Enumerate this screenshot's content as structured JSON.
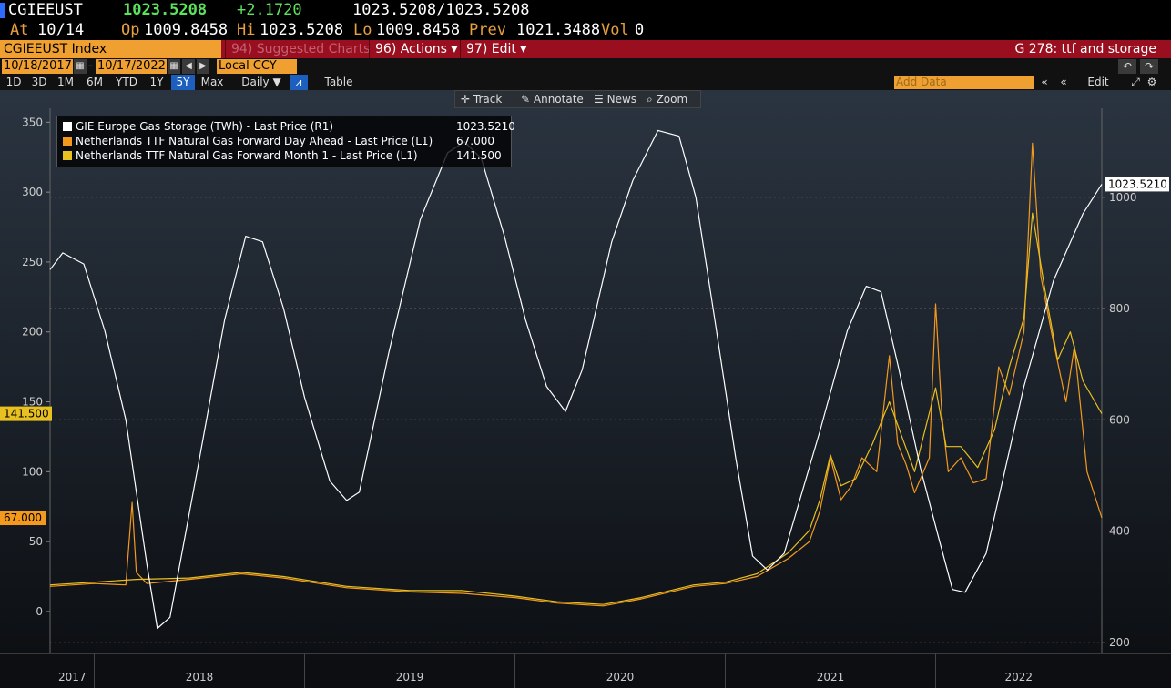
{
  "header": {
    "ticker": "CGIEEUST",
    "last": "1023.5208",
    "change": "+2.1720",
    "bidask": "1023.5208/1023.5208",
    "at_label": "At",
    "at_value": "10/14",
    "op_label": "Op",
    "op_value": "1009.8458",
    "hi_label": "Hi",
    "hi_value": "1023.5208",
    "lo_label": "Lo",
    "lo_value": "1009.8458",
    "prev_label": "Prev",
    "prev_value": "1021.3488",
    "vol_label": "Vol",
    "vol_value": "0"
  },
  "menubar": {
    "security": "CGIEEUST Index",
    "suggested": "94) Suggested Charts",
    "actions": "96) Actions ▾",
    "edit": "97) Edit ▾",
    "title": "G 278: ttf and storage"
  },
  "daterow": {
    "start": "10/18/2017",
    "end": "10/17/2022",
    "currency": "Local CCY"
  },
  "ranges": [
    "1D",
    "3D",
    "1M",
    "6M",
    "YTD",
    "1Y",
    "5Y",
    "Max"
  ],
  "active_range": "5Y",
  "frequency": "Daily ▼",
  "table_label": "Table",
  "add_data_placeholder": "Add Data",
  "edit_chart": "Edit Chart",
  "chart_toolbar": {
    "track": "Track",
    "annotate": "Annotate",
    "news": "News",
    "zoom": "Zoom"
  },
  "colors": {
    "storage": "#ffffff",
    "day_ahead": "#f39a1e",
    "month1": "#e8c020",
    "accent": "#f0a030",
    "menubar": "#9a0f1f"
  },
  "chart_data": {
    "type": "line",
    "x_labels": [
      "2017",
      "2018",
      "2019",
      "2020",
      "2021",
      "2022"
    ],
    "left_axis": {
      "ticks": [
        0,
        50,
        100,
        150,
        200,
        250,
        300,
        350
      ],
      "range": [
        -30,
        360
      ]
    },
    "right_axis": {
      "ticks": [
        200,
        400,
        600,
        800,
        1000
      ],
      "range": [
        180,
        1160
      ]
    },
    "series": [
      {
        "name": "GIE Europe Gas Storage (TWh) - Last Price (R1)",
        "last": "1023.5210",
        "axis": "right",
        "points": [
          [
            2017.79,
            870
          ],
          [
            2017.85,
            900
          ],
          [
            2017.95,
            880
          ],
          [
            2018.05,
            760
          ],
          [
            2018.15,
            600
          ],
          [
            2018.25,
            340
          ],
          [
            2018.3,
            225
          ],
          [
            2018.36,
            245
          ],
          [
            2018.5,
            530
          ],
          [
            2018.62,
            780
          ],
          [
            2018.72,
            930
          ],
          [
            2018.8,
            920
          ],
          [
            2018.9,
            800
          ],
          [
            2019.0,
            640
          ],
          [
            2019.12,
            490
          ],
          [
            2019.2,
            455
          ],
          [
            2019.26,
            470
          ],
          [
            2019.4,
            720
          ],
          [
            2019.55,
            960
          ],
          [
            2019.68,
            1080
          ],
          [
            2019.76,
            1100
          ],
          [
            2019.84,
            1070
          ],
          [
            2019.95,
            930
          ],
          [
            2020.05,
            780
          ],
          [
            2020.15,
            660
          ],
          [
            2020.24,
            615
          ],
          [
            2020.32,
            690
          ],
          [
            2020.46,
            920
          ],
          [
            2020.56,
            1030
          ],
          [
            2020.68,
            1120
          ],
          [
            2020.78,
            1110
          ],
          [
            2020.86,
            1000
          ],
          [
            2020.95,
            780
          ],
          [
            2021.05,
            530
          ],
          [
            2021.13,
            355
          ],
          [
            2021.2,
            330
          ],
          [
            2021.28,
            360
          ],
          [
            2021.45,
            580
          ],
          [
            2021.58,
            760
          ],
          [
            2021.67,
            840
          ],
          [
            2021.74,
            830
          ],
          [
            2021.82,
            700
          ],
          [
            2021.93,
            510
          ],
          [
            2022.02,
            380
          ],
          [
            2022.08,
            295
          ],
          [
            2022.14,
            290
          ],
          [
            2022.24,
            360
          ],
          [
            2022.42,
            660
          ],
          [
            2022.56,
            850
          ],
          [
            2022.7,
            970
          ],
          [
            2022.79,
            1023.5
          ]
        ]
      },
      {
        "name": "Netherlands TTF Natural Gas Forward Day Ahead - Last Price (L1)",
        "last": "67.000",
        "axis": "left",
        "points": [
          [
            2017.79,
            18
          ],
          [
            2018.0,
            20
          ],
          [
            2018.15,
            19
          ],
          [
            2018.18,
            78
          ],
          [
            2018.2,
            28
          ],
          [
            2018.25,
            20
          ],
          [
            2018.45,
            23
          ],
          [
            2018.7,
            27
          ],
          [
            2018.9,
            24
          ],
          [
            2019.2,
            17
          ],
          [
            2019.5,
            14
          ],
          [
            2019.75,
            13
          ],
          [
            2020.0,
            10
          ],
          [
            2020.2,
            6
          ],
          [
            2020.42,
            4
          ],
          [
            2020.6,
            9
          ],
          [
            2020.85,
            18
          ],
          [
            2021.0,
            20
          ],
          [
            2021.15,
            25
          ],
          [
            2021.3,
            38
          ],
          [
            2021.4,
            50
          ],
          [
            2021.45,
            72
          ],
          [
            2021.5,
            110
          ],
          [
            2021.55,
            80
          ],
          [
            2021.6,
            90
          ],
          [
            2021.65,
            110
          ],
          [
            2021.72,
            100
          ],
          [
            2021.78,
            183
          ],
          [
            2021.82,
            120
          ],
          [
            2021.86,
            105
          ],
          [
            2021.9,
            85
          ],
          [
            2021.97,
            110
          ],
          [
            2022.0,
            220
          ],
          [
            2022.03,
            140
          ],
          [
            2022.06,
            100
          ],
          [
            2022.12,
            110
          ],
          [
            2022.18,
            92
          ],
          [
            2022.24,
            95
          ],
          [
            2022.3,
            175
          ],
          [
            2022.35,
            155
          ],
          [
            2022.42,
            200
          ],
          [
            2022.46,
            335
          ],
          [
            2022.5,
            240
          ],
          [
            2022.55,
            200
          ],
          [
            2022.62,
            150
          ],
          [
            2022.66,
            190
          ],
          [
            2022.72,
            100
          ],
          [
            2022.79,
            67
          ]
        ]
      },
      {
        "name": "Netherlands TTF Natural Gas Forward Month 1 - Last Price (L1)",
        "last": "141.500",
        "axis": "left",
        "points": [
          [
            2017.79,
            19
          ],
          [
            2018.0,
            21
          ],
          [
            2018.2,
            23
          ],
          [
            2018.45,
            24
          ],
          [
            2018.7,
            28
          ],
          [
            2018.9,
            25
          ],
          [
            2019.2,
            18
          ],
          [
            2019.5,
            15
          ],
          [
            2019.75,
            15
          ],
          [
            2020.0,
            11
          ],
          [
            2020.2,
            7
          ],
          [
            2020.42,
            5
          ],
          [
            2020.6,
            10
          ],
          [
            2020.85,
            19
          ],
          [
            2021.0,
            21
          ],
          [
            2021.15,
            27
          ],
          [
            2021.3,
            42
          ],
          [
            2021.4,
            58
          ],
          [
            2021.45,
            80
          ],
          [
            2021.5,
            112
          ],
          [
            2021.55,
            90
          ],
          [
            2021.62,
            95
          ],
          [
            2021.7,
            120
          ],
          [
            2021.78,
            150
          ],
          [
            2021.84,
            125
          ],
          [
            2021.9,
            100
          ],
          [
            2022.0,
            160
          ],
          [
            2022.05,
            118
          ],
          [
            2022.12,
            118
          ],
          [
            2022.2,
            103
          ],
          [
            2022.28,
            130
          ],
          [
            2022.35,
            175
          ],
          [
            2022.42,
            210
          ],
          [
            2022.46,
            285
          ],
          [
            2022.52,
            230
          ],
          [
            2022.58,
            180
          ],
          [
            2022.64,
            200
          ],
          [
            2022.7,
            165
          ],
          [
            2022.79,
            141.5
          ]
        ]
      }
    ]
  }
}
